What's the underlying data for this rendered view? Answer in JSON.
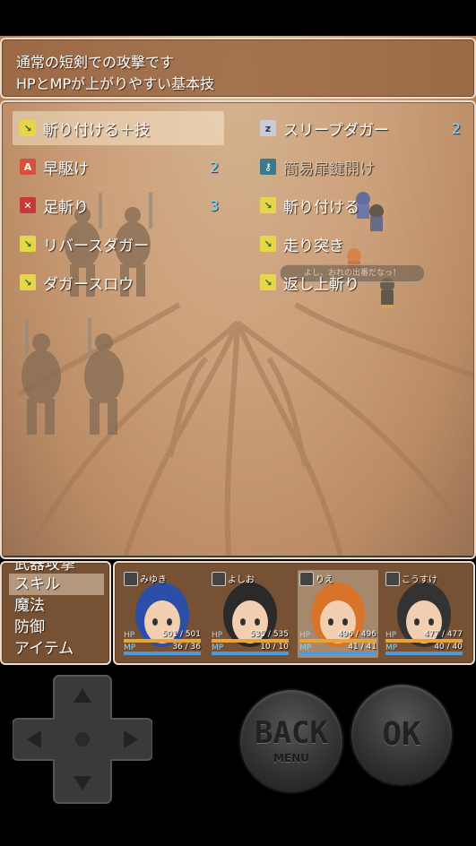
{
  "help": {
    "line1": "通常の短剣での攻撃です",
    "line2": "HPとMPが上がりやすい基本技"
  },
  "skills": [
    {
      "name": "斬り付ける＋技",
      "cost": "",
      "icon": "dagger-icon",
      "selected": true,
      "dim": false
    },
    {
      "name": "スリープダガー",
      "cost": "2",
      "icon": "sleep-icon",
      "selected": false,
      "dim": false
    },
    {
      "name": "早駆け",
      "cost": "2",
      "icon": "agi-icon",
      "selected": false,
      "dim": false
    },
    {
      "name": "簡易扉鍵開け",
      "cost": "",
      "icon": "key-icon",
      "selected": false,
      "dim": true
    },
    {
      "name": "足斬り",
      "cost": "3",
      "icon": "leg-cut-icon",
      "selected": false,
      "dim": false
    },
    {
      "name": "斬り付ける",
      "cost": "",
      "icon": "dagger-icon",
      "selected": false,
      "dim": false
    },
    {
      "name": "リバースダガー",
      "cost": "",
      "icon": "dagger-icon",
      "selected": false,
      "dim": false
    },
    {
      "name": "走り突き",
      "cost": "",
      "icon": "dagger-icon",
      "selected": false,
      "dim": false
    },
    {
      "name": "ダガースロウ",
      "cost": "",
      "icon": "dagger-icon",
      "selected": false,
      "dim": false
    },
    {
      "name": "返し上斬り",
      "cost": "",
      "icon": "dagger-icon",
      "selected": false,
      "dim": false
    }
  ],
  "commands": {
    "partial": "武器攻撃",
    "items": [
      "スキル",
      "魔法",
      "防御",
      "アイテム"
    ],
    "selected_index": 0
  },
  "actors": [
    {
      "name": "みゆき",
      "hp": "501",
      "hp_max": "501",
      "mp": "36",
      "mp_max": "36",
      "hp_label": "HP",
      "mp_label": "MP",
      "hair": "#2b4fa8",
      "selected": false
    },
    {
      "name": "よしお",
      "hp": "535",
      "hp_max": "535",
      "mp": "10",
      "mp_max": "10",
      "hp_label": "HP",
      "mp_label": "MP",
      "hair": "#2a2a2a",
      "selected": false
    },
    {
      "name": "りえ",
      "hp": "496",
      "hp_max": "496",
      "mp": "41",
      "mp_max": "41",
      "hp_label": "HP",
      "mp_label": "MP",
      "hair": "#d8742a",
      "selected": true
    },
    {
      "name": "こうすけ",
      "hp": "477",
      "hp_max": "477",
      "mp": "40",
      "mp_max": "40",
      "hp_label": "HP",
      "mp_label": "MP",
      "hair": "#333333",
      "selected": false
    }
  ],
  "battle_dialog": "よし、おれの出番だなっ！",
  "gamepad": {
    "back_label": "BACK",
    "back_sub": "MENU",
    "ok_label": "OK"
  },
  "colors": {
    "hp_bar": "#e8a33a",
    "mp_bar": "#4a9be0",
    "mp_cost": "#7fd8ff"
  }
}
